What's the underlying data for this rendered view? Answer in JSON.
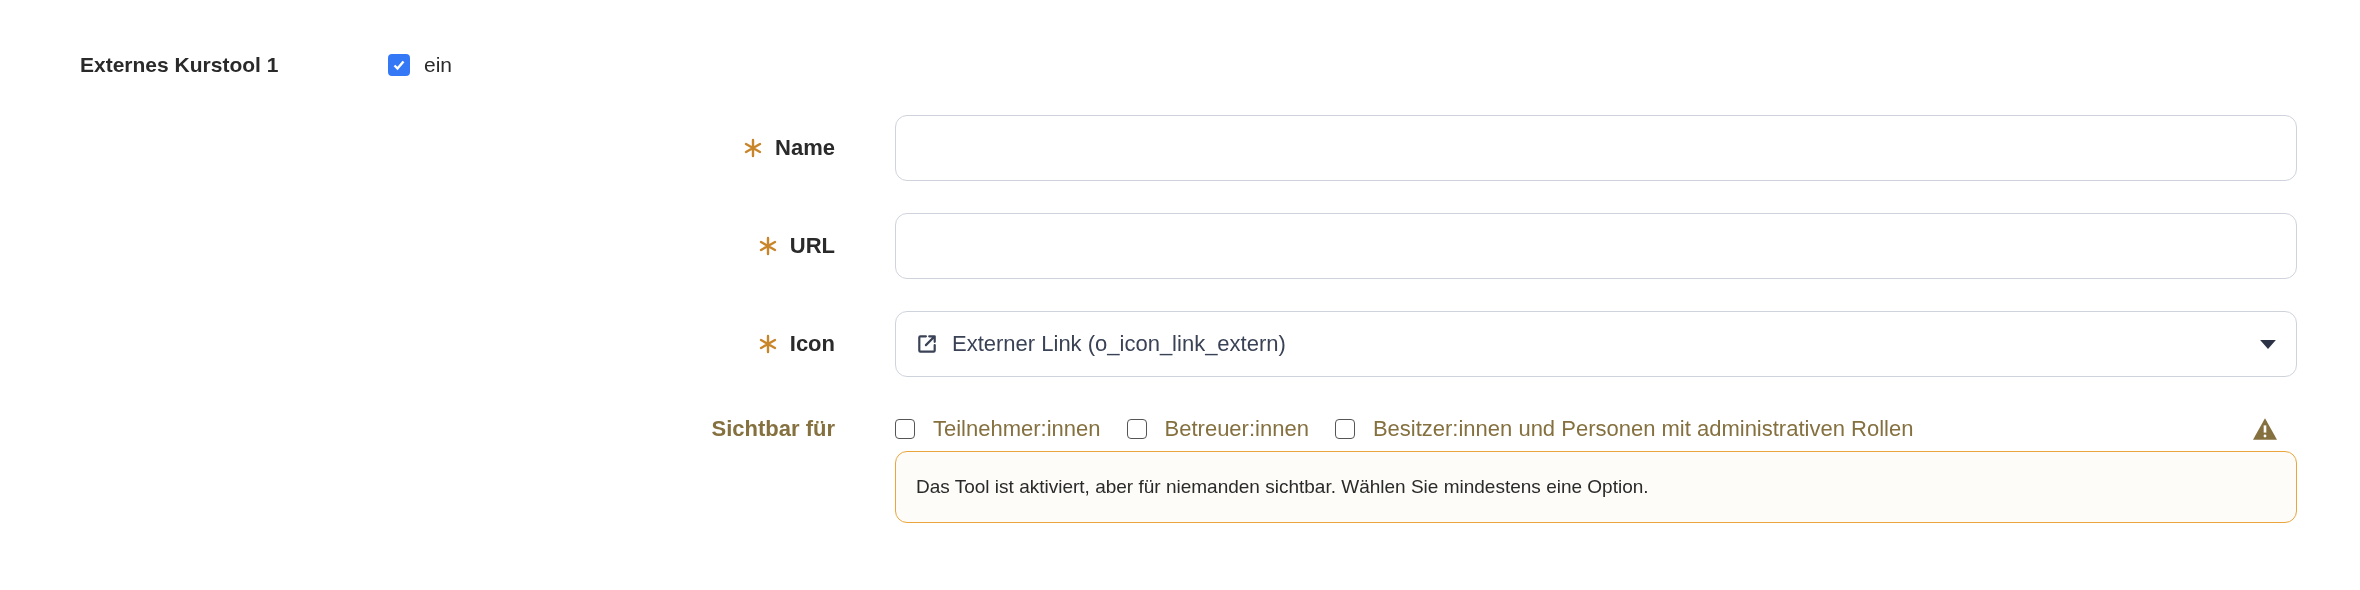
{
  "header": {
    "label": "Externes Kurstool 1",
    "checked": true,
    "option": "ein"
  },
  "fields": [
    {
      "kind": "text",
      "label": "Name",
      "required": true
    },
    {
      "kind": "text",
      "label": "URL",
      "required": true
    },
    {
      "kind": "select",
      "label": "Icon",
      "required": true,
      "value": "Externer Link (o_icon_link_extern)"
    }
  ],
  "visibility": {
    "label": "Sichtbar für",
    "warning": true,
    "options": [
      {
        "label": "Teilnehmer:innen",
        "checked": false
      },
      {
        "label": "Betreuer:innen",
        "checked": false
      },
      {
        "label": "Besitzer:innen und Personen mit administrativen Rollen",
        "checked": false
      }
    ],
    "message": "Das Tool ist aktiviert, aber für niemanden sichtbar. Wählen Sie mindestens eine Option."
  }
}
